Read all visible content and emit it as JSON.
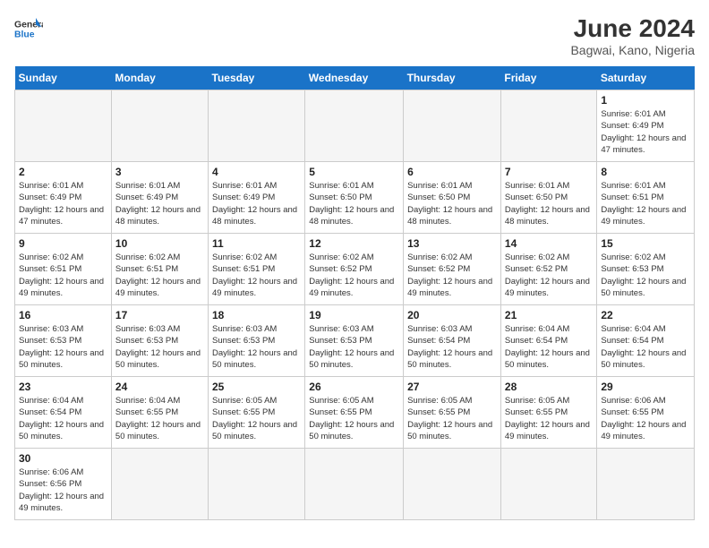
{
  "header": {
    "logo_general": "General",
    "logo_blue": "Blue",
    "month_title": "June 2024",
    "location": "Bagwai, Kano, Nigeria"
  },
  "weekdays": [
    "Sunday",
    "Monday",
    "Tuesday",
    "Wednesday",
    "Thursday",
    "Friday",
    "Saturday"
  ],
  "weeks": [
    [
      {
        "day": "",
        "info": ""
      },
      {
        "day": "",
        "info": ""
      },
      {
        "day": "",
        "info": ""
      },
      {
        "day": "",
        "info": ""
      },
      {
        "day": "",
        "info": ""
      },
      {
        "day": "",
        "info": ""
      },
      {
        "day": "1",
        "info": "Sunrise: 6:01 AM\nSunset: 6:49 PM\nDaylight: 12 hours and 47 minutes."
      }
    ],
    [
      {
        "day": "2",
        "info": "Sunrise: 6:01 AM\nSunset: 6:49 PM\nDaylight: 12 hours and 47 minutes."
      },
      {
        "day": "3",
        "info": "Sunrise: 6:01 AM\nSunset: 6:49 PM\nDaylight: 12 hours and 48 minutes."
      },
      {
        "day": "4",
        "info": "Sunrise: 6:01 AM\nSunset: 6:49 PM\nDaylight: 12 hours and 48 minutes."
      },
      {
        "day": "5",
        "info": "Sunrise: 6:01 AM\nSunset: 6:50 PM\nDaylight: 12 hours and 48 minutes."
      },
      {
        "day": "6",
        "info": "Sunrise: 6:01 AM\nSunset: 6:50 PM\nDaylight: 12 hours and 48 minutes."
      },
      {
        "day": "7",
        "info": "Sunrise: 6:01 AM\nSunset: 6:50 PM\nDaylight: 12 hours and 48 minutes."
      },
      {
        "day": "8",
        "info": "Sunrise: 6:01 AM\nSunset: 6:51 PM\nDaylight: 12 hours and 49 minutes."
      }
    ],
    [
      {
        "day": "9",
        "info": "Sunrise: 6:02 AM\nSunset: 6:51 PM\nDaylight: 12 hours and 49 minutes."
      },
      {
        "day": "10",
        "info": "Sunrise: 6:02 AM\nSunset: 6:51 PM\nDaylight: 12 hours and 49 minutes."
      },
      {
        "day": "11",
        "info": "Sunrise: 6:02 AM\nSunset: 6:51 PM\nDaylight: 12 hours and 49 minutes."
      },
      {
        "day": "12",
        "info": "Sunrise: 6:02 AM\nSunset: 6:52 PM\nDaylight: 12 hours and 49 minutes."
      },
      {
        "day": "13",
        "info": "Sunrise: 6:02 AM\nSunset: 6:52 PM\nDaylight: 12 hours and 49 minutes."
      },
      {
        "day": "14",
        "info": "Sunrise: 6:02 AM\nSunset: 6:52 PM\nDaylight: 12 hours and 49 minutes."
      },
      {
        "day": "15",
        "info": "Sunrise: 6:02 AM\nSunset: 6:53 PM\nDaylight: 12 hours and 50 minutes."
      }
    ],
    [
      {
        "day": "16",
        "info": "Sunrise: 6:03 AM\nSunset: 6:53 PM\nDaylight: 12 hours and 50 minutes."
      },
      {
        "day": "17",
        "info": "Sunrise: 6:03 AM\nSunset: 6:53 PM\nDaylight: 12 hours and 50 minutes."
      },
      {
        "day": "18",
        "info": "Sunrise: 6:03 AM\nSunset: 6:53 PM\nDaylight: 12 hours and 50 minutes."
      },
      {
        "day": "19",
        "info": "Sunrise: 6:03 AM\nSunset: 6:53 PM\nDaylight: 12 hours and 50 minutes."
      },
      {
        "day": "20",
        "info": "Sunrise: 6:03 AM\nSunset: 6:54 PM\nDaylight: 12 hours and 50 minutes."
      },
      {
        "day": "21",
        "info": "Sunrise: 6:04 AM\nSunset: 6:54 PM\nDaylight: 12 hours and 50 minutes."
      },
      {
        "day": "22",
        "info": "Sunrise: 6:04 AM\nSunset: 6:54 PM\nDaylight: 12 hours and 50 minutes."
      }
    ],
    [
      {
        "day": "23",
        "info": "Sunrise: 6:04 AM\nSunset: 6:54 PM\nDaylight: 12 hours and 50 minutes."
      },
      {
        "day": "24",
        "info": "Sunrise: 6:04 AM\nSunset: 6:55 PM\nDaylight: 12 hours and 50 minutes."
      },
      {
        "day": "25",
        "info": "Sunrise: 6:05 AM\nSunset: 6:55 PM\nDaylight: 12 hours and 50 minutes."
      },
      {
        "day": "26",
        "info": "Sunrise: 6:05 AM\nSunset: 6:55 PM\nDaylight: 12 hours and 50 minutes."
      },
      {
        "day": "27",
        "info": "Sunrise: 6:05 AM\nSunset: 6:55 PM\nDaylight: 12 hours and 50 minutes."
      },
      {
        "day": "28",
        "info": "Sunrise: 6:05 AM\nSunset: 6:55 PM\nDaylight: 12 hours and 49 minutes."
      },
      {
        "day": "29",
        "info": "Sunrise: 6:06 AM\nSunset: 6:55 PM\nDaylight: 12 hours and 49 minutes."
      }
    ],
    [
      {
        "day": "30",
        "info": "Sunrise: 6:06 AM\nSunset: 6:56 PM\nDaylight: 12 hours and 49 minutes."
      },
      {
        "day": "",
        "info": ""
      },
      {
        "day": "",
        "info": ""
      },
      {
        "day": "",
        "info": ""
      },
      {
        "day": "",
        "info": ""
      },
      {
        "day": "",
        "info": ""
      },
      {
        "day": "",
        "info": ""
      }
    ]
  ]
}
